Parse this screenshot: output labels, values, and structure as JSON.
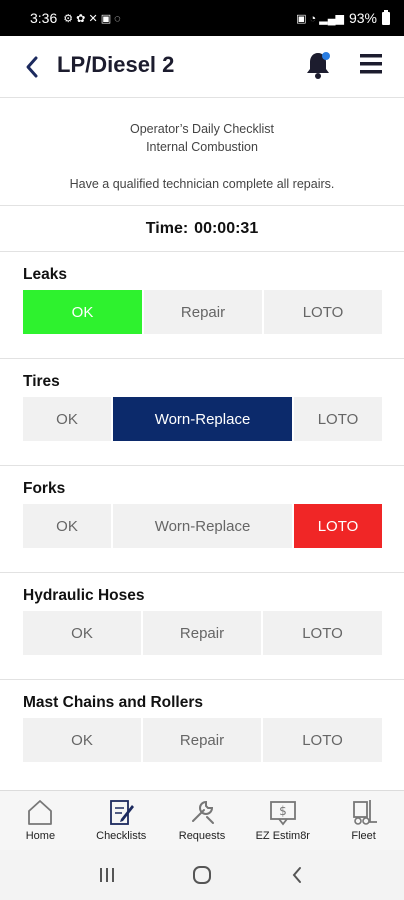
{
  "status_bar": {
    "time": "3:36",
    "battery": "93%"
  },
  "header": {
    "title": "LP/Diesel 2"
  },
  "intro": {
    "line1": "Operator’s Daily Checklist",
    "line2": "Internal Combustion",
    "line3": "Have a qualified technician complete all repairs."
  },
  "timer": {
    "label": "Time:",
    "value": "00:00:31"
  },
  "items": [
    {
      "title": "Leaks",
      "options": [
        "OK",
        "Repair",
        "LOTO"
      ],
      "selected": "OK"
    },
    {
      "title": "Tires",
      "options": [
        "OK",
        "Worn-Replace",
        "LOTO"
      ],
      "selected": "Worn-Replace"
    },
    {
      "title": "Forks",
      "options": [
        "OK",
        "Worn-Replace",
        "LOTO"
      ],
      "selected": "LOTO"
    },
    {
      "title": "Hydraulic Hoses",
      "options": [
        "OK",
        "Repair",
        "LOTO"
      ],
      "selected": ""
    },
    {
      "title": "Mast Chains and Rollers",
      "options": [
        "OK",
        "Repair",
        "LOTO"
      ],
      "selected": ""
    }
  ],
  "bottom_nav": [
    {
      "label": "Home",
      "icon": "home-icon"
    },
    {
      "label": "Checklists",
      "icon": "checklist-icon"
    },
    {
      "label": "Requests",
      "icon": "wrench-icon"
    },
    {
      "label": "EZ Estim8r",
      "icon": "dollar-screen-icon"
    },
    {
      "label": "Fleet",
      "icon": "forklift-icon"
    }
  ],
  "colors": {
    "ok_selected": "#2ef22e",
    "navy_selected": "#0c2a6b",
    "loto_selected": "#f02626",
    "brand": "#1c2a5e"
  }
}
